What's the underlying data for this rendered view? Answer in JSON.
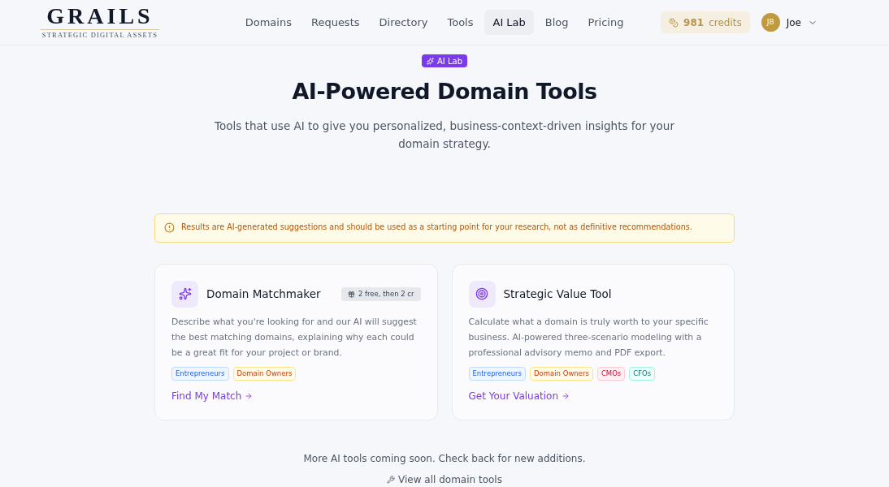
{
  "logo": {
    "name": "GRAILS",
    "tagline": "STRATEGIC DIGITAL ASSETS"
  },
  "nav": [
    {
      "label": "Domains",
      "selected": false
    },
    {
      "label": "Requests",
      "selected": false
    },
    {
      "label": "Directory",
      "selected": false
    },
    {
      "label": "Tools",
      "selected": false
    },
    {
      "label": "AI Lab",
      "selected": true
    },
    {
      "label": "Blog",
      "selected": false
    },
    {
      "label": "Pricing",
      "selected": false
    }
  ],
  "credits": {
    "amount": "981",
    "unit": "credits"
  },
  "user": {
    "initials": "JB",
    "name": "Joe"
  },
  "hero": {
    "badge": "AI Lab",
    "title": "AI-Powered Domain Tools",
    "subtitle": "Tools that use AI to give you personalized, business-context-driven insights for your domain strategy."
  },
  "notice": "Results are AI-generated suggestions and should be used as a starting point for your research, not as definitive recommendations.",
  "tools": [
    {
      "kind": "sparkle",
      "title": "Domain Matchmaker",
      "badge": "2 free, then 2 cr",
      "description": "Describe what you're looking for and our AI will suggest the best matching domains, explaining why each could be a great fit for your project or brand.",
      "tags": [
        {
          "label": "Entrepreneurs",
          "color": "#eff6ff"
        },
        {
          "label": "Domain Owners",
          "color": "#fffbeb"
        }
      ],
      "link": "Find My Match"
    },
    {
      "kind": "target",
      "title": "Strategic Value Tool",
      "description": "Calculate what a domain is truly worth to your specific business. AI-powered three-scenario modeling with a professional advisory memo and PDF export.",
      "tags": [
        {
          "label": "Entrepreneurs",
          "color": "#eff6ff"
        },
        {
          "label": "Domain Owners",
          "color": "#fffbeb"
        },
        {
          "label": "CMOs",
          "color": "#fff1f2"
        },
        {
          "label": "CFOs",
          "color": "#f0fdfa"
        }
      ],
      "link": "Get Your Valuation"
    }
  ],
  "footer": {
    "note": "More AI tools coming soon. Check back for new additions.",
    "link": "View all domain tools"
  }
}
